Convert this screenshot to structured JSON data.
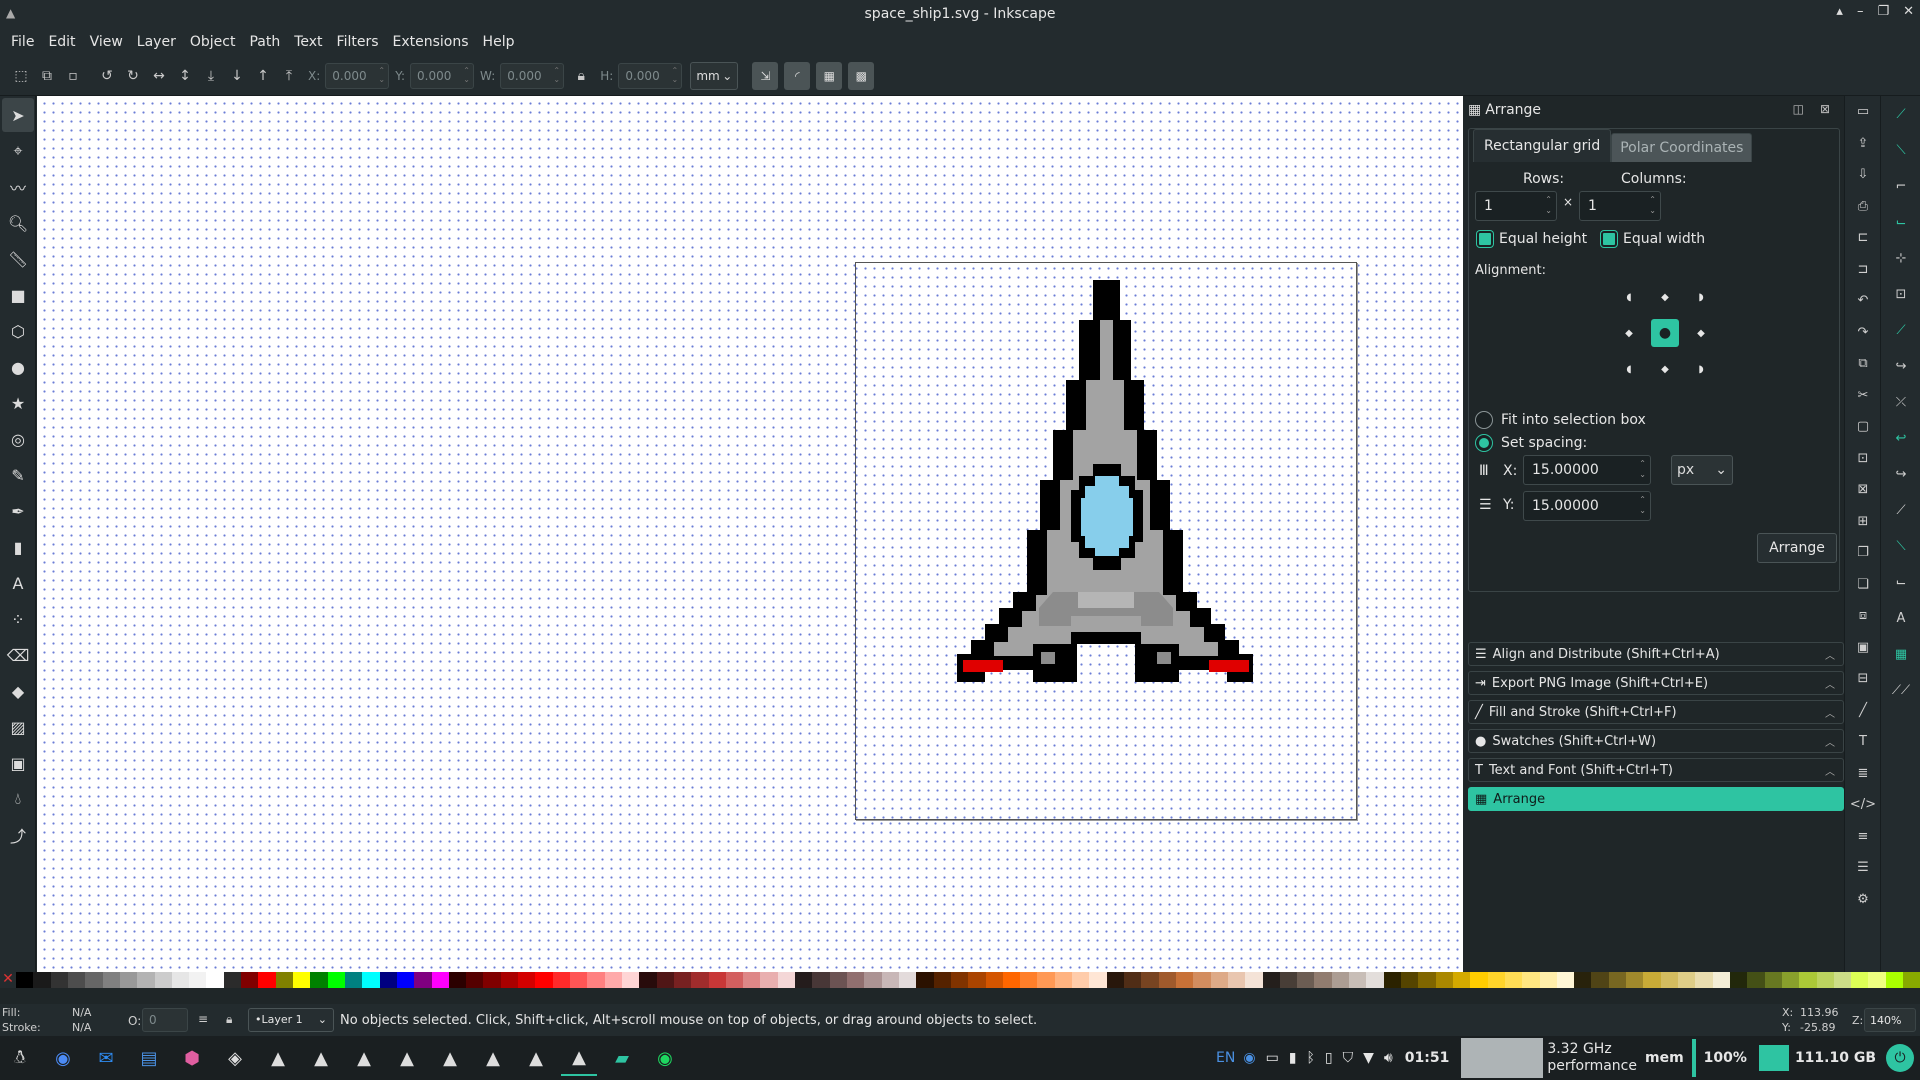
{
  "window": {
    "title": "space_ship1.svg - Inkscape"
  },
  "menu": [
    "File",
    "Edit",
    "View",
    "Layer",
    "Object",
    "Path",
    "Text",
    "Filters",
    "Extensions",
    "Help"
  ],
  "toolbar": {
    "x_label": "X:",
    "x_value": "0.000",
    "y_label": "Y:",
    "y_value": "0.000",
    "w_label": "W:",
    "w_value": "0.000",
    "h_label": "H:",
    "h_value": "0.000",
    "unit": "mm"
  },
  "arrange": {
    "title": "Arrange",
    "tab_active": "Rectangular grid",
    "tab_inactive": "Polar Coordinates",
    "rows_label": "Rows:",
    "rows_value": "1",
    "cols_label": "Columns:",
    "cols_value": "1",
    "times": "×",
    "equal_height": "Equal height",
    "equal_width": "Equal width",
    "alignment_label": "Alignment:",
    "fit_label": "Fit into selection box",
    "spacing_label": "Set spacing:",
    "x_label": "X:",
    "x_value": "15.00000",
    "y_label": "Y:",
    "y_value": "15.00000",
    "spacing_unit": "px",
    "arrange_button": "Arrange"
  },
  "dialogs": [
    {
      "label": "Align and Distribute (Shift+Ctrl+A)",
      "icon": "align-icon"
    },
    {
      "label": "Export PNG Image (Shift+Ctrl+E)",
      "icon": "export-icon"
    },
    {
      "label": "Fill and Stroke (Shift+Ctrl+F)",
      "icon": "brush-icon"
    },
    {
      "label": "Swatches (Shift+Ctrl+W)",
      "icon": "drop-icon"
    },
    {
      "label": "Text and Font (Shift+Ctrl+T)",
      "icon": "text-icon"
    },
    {
      "label": "Arrange",
      "icon": "grid-icon"
    }
  ],
  "status": {
    "fill_label": "Fill:",
    "fill_value": "N/A",
    "stroke_label": "Stroke:",
    "stroke_value": "N/A",
    "opacity_label": "O:",
    "opacity_value": "0",
    "layer": "•Layer 1",
    "message": "No objects selected. Click, Shift+click, Alt+scroll mouse on top of objects, or drag around objects to select.",
    "cursor_x_label": "X:",
    "cursor_x": "113.96",
    "cursor_y_label": "Y:",
    "cursor_y": "-25.89",
    "zoom_label": "Z:",
    "zoom": "140%"
  },
  "taskbar": {
    "lang": "EN",
    "time": "01:51",
    "cpu_freq": "3.32 GHz",
    "cpu_mode": "performance",
    "mem_label": "mem",
    "mem_percent": "100%",
    "disk": "111.10 GB"
  },
  "colors": {
    "accent": "#2ec4a2",
    "ship_gray": "#a3a3a3",
    "ship_dark": "#8c8c8c",
    "cockpit": "#87ceeb",
    "thruster": "#e00000"
  }
}
